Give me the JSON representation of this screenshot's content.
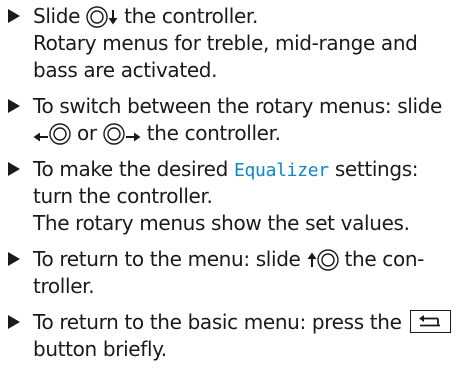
{
  "items": [
    {
      "l1_pre": "Slide ",
      "l1_post": " the controller.",
      "l2": "Rotary menus for treble, mid-range and",
      "l3": "bass are activated."
    },
    {
      "l1": "To switch between the rotary menus: slide",
      "l2_or": " or ",
      "l2_post": " the controller."
    },
    {
      "l1_pre": "To make the desired ",
      "l1_highlight": "Equalizer",
      "l1_post": " settings:",
      "l2": "turn the controller.",
      "l3": "The rotary menus show the set values."
    },
    {
      "l1_pre": "To return to the menu: slide ",
      "l1_post": " the con-",
      "l2": "troller."
    },
    {
      "l1_pre": "To return to the basic menu: press the ",
      "l2": "button briefly."
    }
  ],
  "icons": {
    "bullet": "triangle-right",
    "controller": "rotary-controller",
    "back_button": "back-arrow",
    "slide_down": "arrow-down",
    "slide_left": "arrow-left",
    "slide_right": "arrow-right",
    "slide_up": "arrow-up"
  },
  "colors": {
    "text": "#1a1a1a",
    "highlight": "#0f86c6"
  }
}
